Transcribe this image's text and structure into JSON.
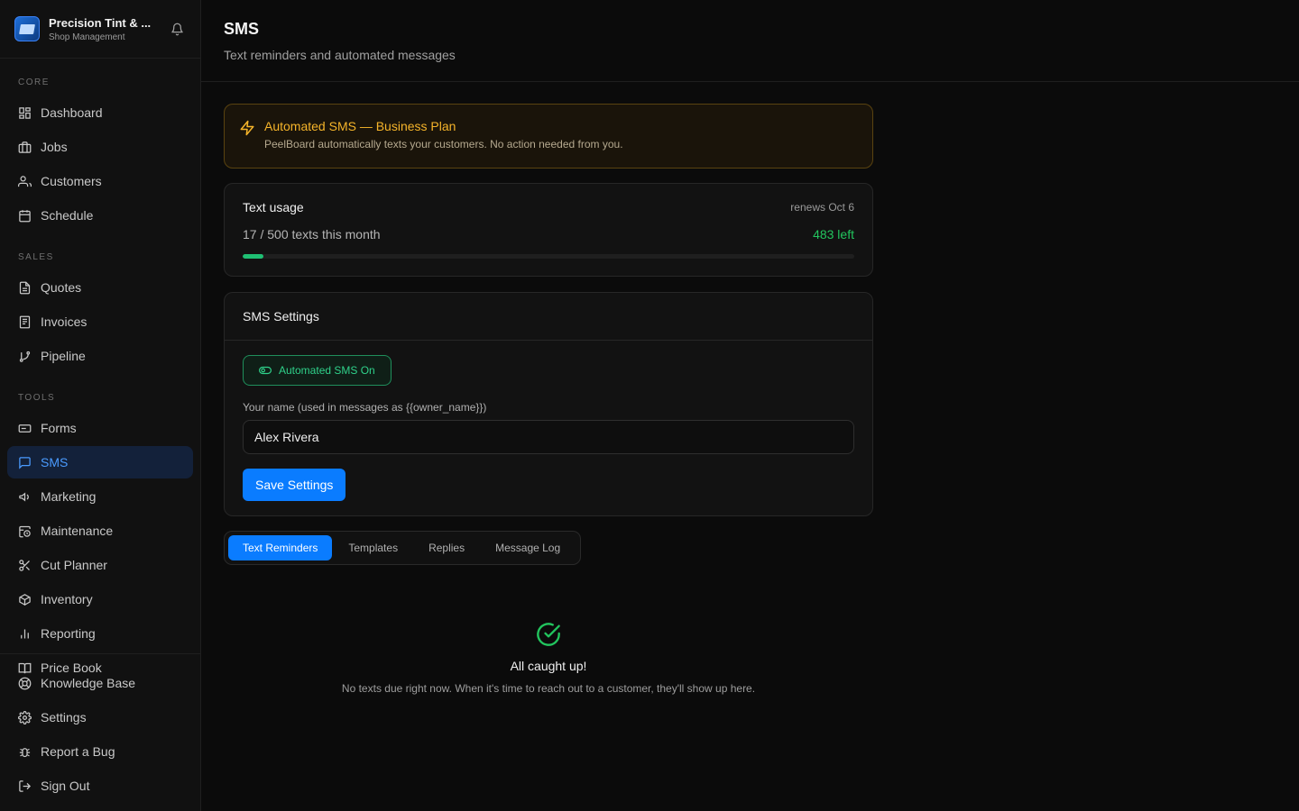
{
  "brand": {
    "name": "Precision Tint & ...",
    "subtitle": "Shop Management"
  },
  "sidebar": {
    "sections": [
      {
        "label": "CORE",
        "items": [
          {
            "label": "Dashboard",
            "icon": "dashboard-icon"
          },
          {
            "label": "Jobs",
            "icon": "briefcase-icon"
          },
          {
            "label": "Customers",
            "icon": "users-icon"
          },
          {
            "label": "Schedule",
            "icon": "calendar-icon"
          }
        ]
      },
      {
        "label": "SALES",
        "items": [
          {
            "label": "Quotes",
            "icon": "document-icon"
          },
          {
            "label": "Invoices",
            "icon": "receipt-icon"
          },
          {
            "label": "Pipeline",
            "icon": "branch-icon"
          }
        ]
      },
      {
        "label": "TOOLS",
        "items": [
          {
            "label": "Forms",
            "icon": "form-icon"
          },
          {
            "label": "SMS",
            "icon": "message-icon"
          },
          {
            "label": "Marketing",
            "icon": "megaphone-icon"
          },
          {
            "label": "Maintenance",
            "icon": "calendar-clock-icon"
          },
          {
            "label": "Cut Planner",
            "icon": "scissors-icon"
          },
          {
            "label": "Inventory",
            "icon": "box-icon"
          },
          {
            "label": "Reporting",
            "icon": "bar-chart-icon"
          },
          {
            "label": "Price Book",
            "icon": "book-icon"
          }
        ]
      }
    ],
    "bottom": [
      {
        "label": "Knowledge Base",
        "icon": "lifebuoy-icon"
      },
      {
        "label": "Settings",
        "icon": "gear-icon"
      },
      {
        "label": "Report a Bug",
        "icon": "bug-icon"
      },
      {
        "label": "Sign Out",
        "icon": "sign-out-icon"
      }
    ],
    "active": "SMS"
  },
  "header": {
    "title": "SMS",
    "subtitle": "Text reminders and automated messages"
  },
  "promo": {
    "title": "Automated SMS — Business Plan",
    "description": "PeelBoard automatically texts your customers. No action needed from you.",
    "accent": "#f5b42a"
  },
  "usage": {
    "title": "Text usage",
    "renews": "renews Oct 6",
    "count_text": "17 / 500 texts this month",
    "left_text": "483 left",
    "used": 17,
    "limit": 500,
    "fill_color": "#1fbf73"
  },
  "settings": {
    "title": "SMS Settings",
    "toggle_label": "Automated SMS On",
    "name_label": "Your name (used in messages as {{owner_name}})",
    "name_value": "Alex Rivera",
    "save_label": "Save Settings"
  },
  "tabs": [
    {
      "label": "Text Reminders",
      "active": true
    },
    {
      "label": "Templates",
      "active": false
    },
    {
      "label": "Replies",
      "active": false
    },
    {
      "label": "Message Log",
      "active": false
    }
  ],
  "empty_state": {
    "title": "All caught up!",
    "description": "No texts due right now. When it's time to reach out to a customer, they'll show up here."
  },
  "colors": {
    "accent": "#0a7cff",
    "success": "#22c55e"
  }
}
